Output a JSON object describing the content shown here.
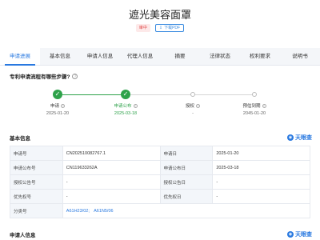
{
  "header": {
    "title": "遮光美容面罩",
    "status_badge": "审中",
    "download_label": "下载PDF"
  },
  "tabs": [
    {
      "label": "申请进展",
      "active": true
    },
    {
      "label": "基本信息",
      "active": false
    },
    {
      "label": "申请人信息",
      "active": false
    },
    {
      "label": "代理人信息",
      "active": false
    },
    {
      "label": "摘要",
      "active": false
    },
    {
      "label": "法律状态",
      "active": false
    },
    {
      "label": "权利要求",
      "active": false
    },
    {
      "label": "说明书",
      "active": false
    }
  ],
  "progress": {
    "question": "专利申请流程有哪些步骤?",
    "steps": [
      {
        "label": "申请",
        "date": "2025-01-20",
        "state": "done"
      },
      {
        "label": "申请公布",
        "date": "2025-03-18",
        "state": "current"
      },
      {
        "label": "授权",
        "date": "-",
        "state": "todo"
      },
      {
        "label": "预估到期",
        "date": "2045-01-20",
        "state": "todo"
      }
    ]
  },
  "basic_info": {
    "title": "基本信息",
    "brand": "天眼查",
    "rows": [
      {
        "l1": "申请号",
        "v1": "CN202510082767.1",
        "l2": "申请日",
        "v2": "2025-01-20"
      },
      {
        "l1": "申请公布号",
        "v1": "CN119633262A",
        "l2": "申请公布日",
        "v2": "2025-03-18"
      },
      {
        "l1": "授权公告号",
        "v1": "-",
        "l2": "授权公告日",
        "v2": "-"
      },
      {
        "l1": "优先权号",
        "v1": "-",
        "l2": "优先权日",
        "v2": "-"
      }
    ],
    "class_label": "分类号",
    "class_links": [
      "A61H23/02;",
      "A61N5/06"
    ]
  },
  "applicant_info": {
    "title": "申请人信息",
    "brand": "天眼查"
  },
  "colors": {
    "accent": "#2979e0",
    "success": "#2ea24a",
    "status_red": "#e04848"
  }
}
